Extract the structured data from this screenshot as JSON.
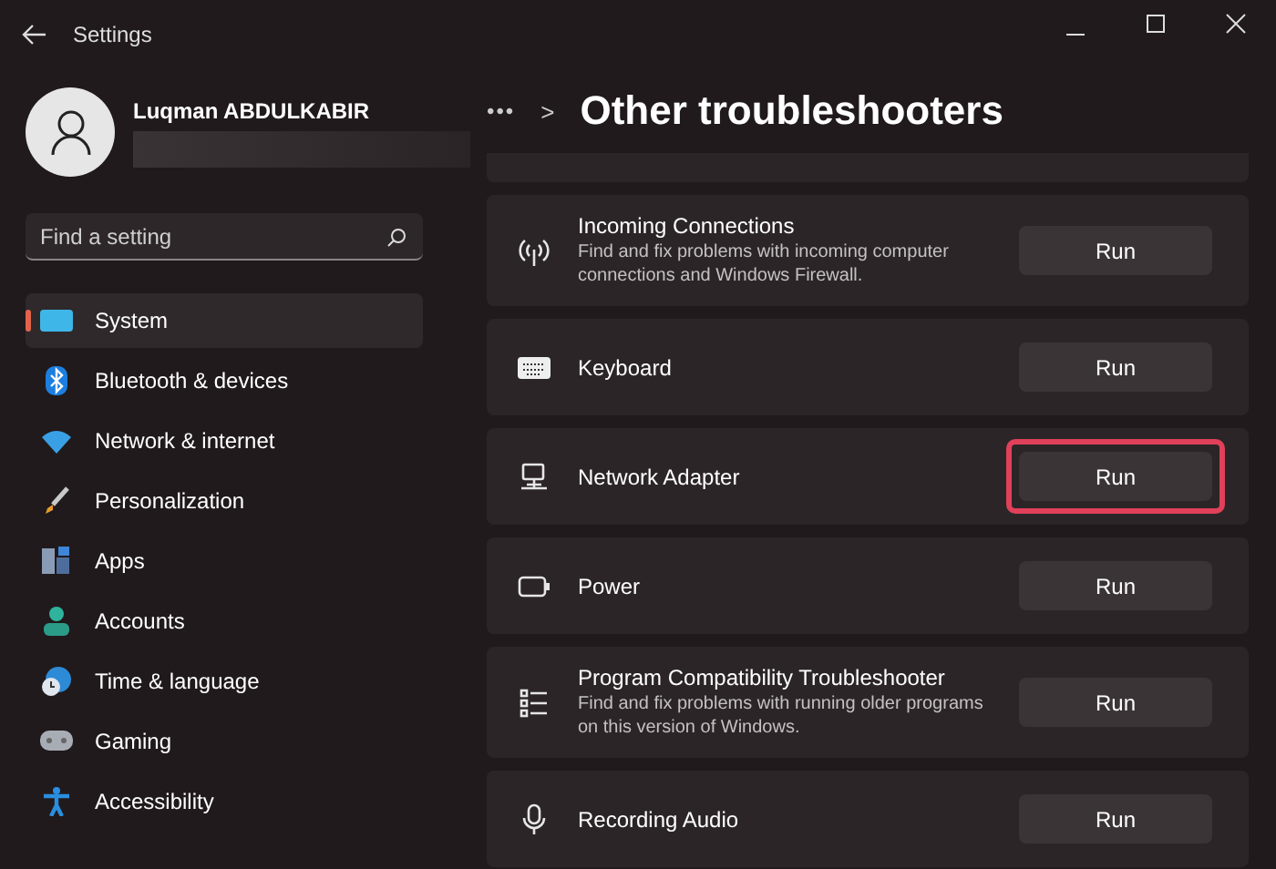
{
  "window": {
    "title": "Settings"
  },
  "profile": {
    "name": "Luqman ABDULKABIR"
  },
  "search": {
    "placeholder": "Find a setting"
  },
  "nav": [
    {
      "label": "System",
      "selected": true
    },
    {
      "label": "Bluetooth & devices",
      "selected": false
    },
    {
      "label": "Network & internet",
      "selected": false
    },
    {
      "label": "Personalization",
      "selected": false
    },
    {
      "label": "Apps",
      "selected": false
    },
    {
      "label": "Accounts",
      "selected": false
    },
    {
      "label": "Time & language",
      "selected": false
    },
    {
      "label": "Gaming",
      "selected": false
    },
    {
      "label": "Accessibility",
      "selected": false
    }
  ],
  "breadcrumb": {
    "more": "•••",
    "separator": ">",
    "title": "Other troubleshooters"
  },
  "troubleshooters": [
    {
      "title": "Incoming Connections",
      "description": "Find and fix problems with incoming computer connections and Windows Firewall.",
      "button": "Run",
      "highlighted": false
    },
    {
      "title": "Keyboard",
      "button": "Run",
      "highlighted": false
    },
    {
      "title": "Network Adapter",
      "button": "Run",
      "highlighted": true
    },
    {
      "title": "Power",
      "button": "Run",
      "highlighted": false
    },
    {
      "title": "Program Compatibility Troubleshooter",
      "description": "Find and fix problems with running older programs on this version of Windows.",
      "button": "Run",
      "highlighted": false
    },
    {
      "title": "Recording Audio",
      "button": "Run",
      "highlighted": false
    }
  ]
}
